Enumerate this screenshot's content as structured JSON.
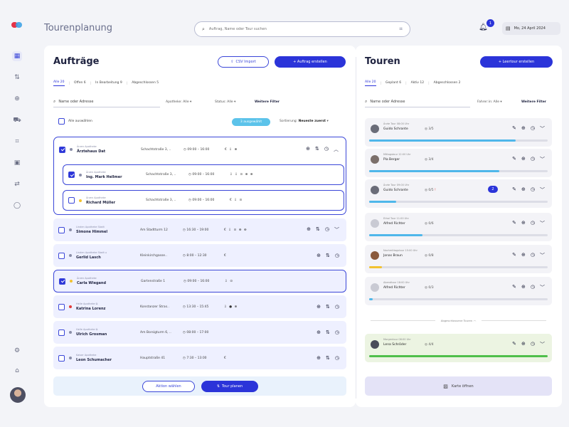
{
  "topbar": {
    "title": "Tourenplanung",
    "search_placeholder": "Auftrag, Name oder Tour suchen",
    "notification_count": "1",
    "date": "Mo, 24 April 2024"
  },
  "orders": {
    "title": "Aufträge",
    "csv_import": "CSV Import",
    "create_order": "+ Auftrag erstellen",
    "tabs": [
      "Alle 20",
      "Offen 6",
      "In Bearbeitung 9",
      "Abgeschlossen 5"
    ],
    "search_placeholder": "Name oder Adresse",
    "filter_pharmacy": "Apotheke: Alle",
    "filter_status": "Status: Alle",
    "more_filters": "Weitere Filter",
    "select_all": "Alle auswählen",
    "selected_chip": "3 ausgewählt",
    "sort_label": "Sortierung:",
    "sort_value": "Neueste zuerst",
    "rows": [
      {
        "sub": "Ärzen Apotheke",
        "name": "Ärztehaus Dat",
        "addr": "Schachtstraße 3, ..",
        "time": "09:00 – 16:00",
        "icons": "€ ⇩ ⊕"
      },
      {
        "sub": "Ärzen Apotheke",
        "name": "Ing. Mark Hellmer",
        "addr": "Schachtstraße 3, ..",
        "time": "09:00 – 16:00",
        "icons": "⇩ ⇩ ⊙ ⊕ ⊕"
      },
      {
        "sub": "Ärzen Apotheke",
        "name": "Richard Müller",
        "addr": "Schachtstraße 3, ..",
        "time": "09:00 – 16:00",
        "icons": "€ ⇩ ⊙"
      },
      {
        "sub": "Linden Apotheke Stadt",
        "name": "Simone Himmel",
        "addr": "Am Stadtturm 12",
        "time": "16:30 – 19:00",
        "icons": "€ ⇩ ⊙ ⊕ ⊕"
      },
      {
        "sub": "Linden Apotheke Stadt",
        "name": "Gerlid Lasch",
        "addr": "Kleinkirchgasse..",
        "time": "8:00 – 12:30",
        "icons": "€"
      },
      {
        "sub": "Ärzen Apotheke",
        "name": "Carla Wiegand",
        "addr": "Gartenstraße 1",
        "time": "09:00 – 16:00",
        "icons": "⇩ ⊙"
      },
      {
        "sub": "Helle Apotheke",
        "name": "Katrina Lorenz",
        "addr": "Konstanzer Stras..",
        "time": "13:30 – 15:45",
        "icons": "⇩ ● ⊕"
      },
      {
        "sub": "Helle Apotheke",
        "name": "Ulrich Grosman",
        "addr": "Am Borsigturm 6, ..",
        "time": "08:00 – 17:00",
        "icons": ""
      },
      {
        "sub": "Kaiser Apotheke",
        "name": "Leon Schumacher",
        "addr": "Hauptstraße 41",
        "time": "7:30 – 13:00",
        "icons": "€"
      }
    ],
    "action_select": "Aktion wählen",
    "plan_tour": "Tour planen"
  },
  "tours": {
    "title": "Touren",
    "create_empty": "+ Leertour erstellen",
    "tabs": [
      "Alle 20",
      "Geplant 6",
      "Aktiv 12",
      "Abgeschlossen 2"
    ],
    "search_placeholder": "Name oder Adresse",
    "filter_driver": "Fahrer:in: Alle",
    "more_filters": "Weitere Filter",
    "items": [
      {
        "sub": "Ärzte Tour 08:00 Uhr",
        "driver": "Guido Schrante",
        "stops": "3/5",
        "progress": 0.82,
        "color": "#4fb7ea"
      },
      {
        "sub": "Mittagstour 12:00 Uhr",
        "driver": "Pia Berger",
        "stops": "3/4",
        "progress": 0.73,
        "color": "#4fb7ea"
      },
      {
        "sub": "Ärzte Tour 09:00 Uhr",
        "driver": "Guido Schrante",
        "stops": "0/5",
        "progress": 0.15,
        "color": "#4fb7ea",
        "warn": "!",
        "badge": "2"
      },
      {
        "sub": "Ethal Tour 11:00 Uhr",
        "driver": "Alfred Richter",
        "stops": "0/6",
        "progress": 0.3,
        "color": "#4fb7ea"
      },
      {
        "sub": "Nachmittagstour 15:00 Uhr",
        "driver": "Jonas Braun",
        "stops": "0/8",
        "progress": 0.07,
        "color": "#f2c230"
      },
      {
        "sub": "Abendtour 18:00 Uhr",
        "driver": "Alfred Richter",
        "stops": "0/3",
        "progress": 0.02,
        "color": "#4fb7ea"
      }
    ],
    "closed_label": "Abgeschlossene Touren",
    "done_tour": {
      "sub": "Morgentour 08:00 Uhr",
      "driver": "Lena Schröder",
      "stops": "4/4",
      "progress": 1.0,
      "color": "#4fbf4a"
    },
    "map_button": "Karte öffnen"
  }
}
